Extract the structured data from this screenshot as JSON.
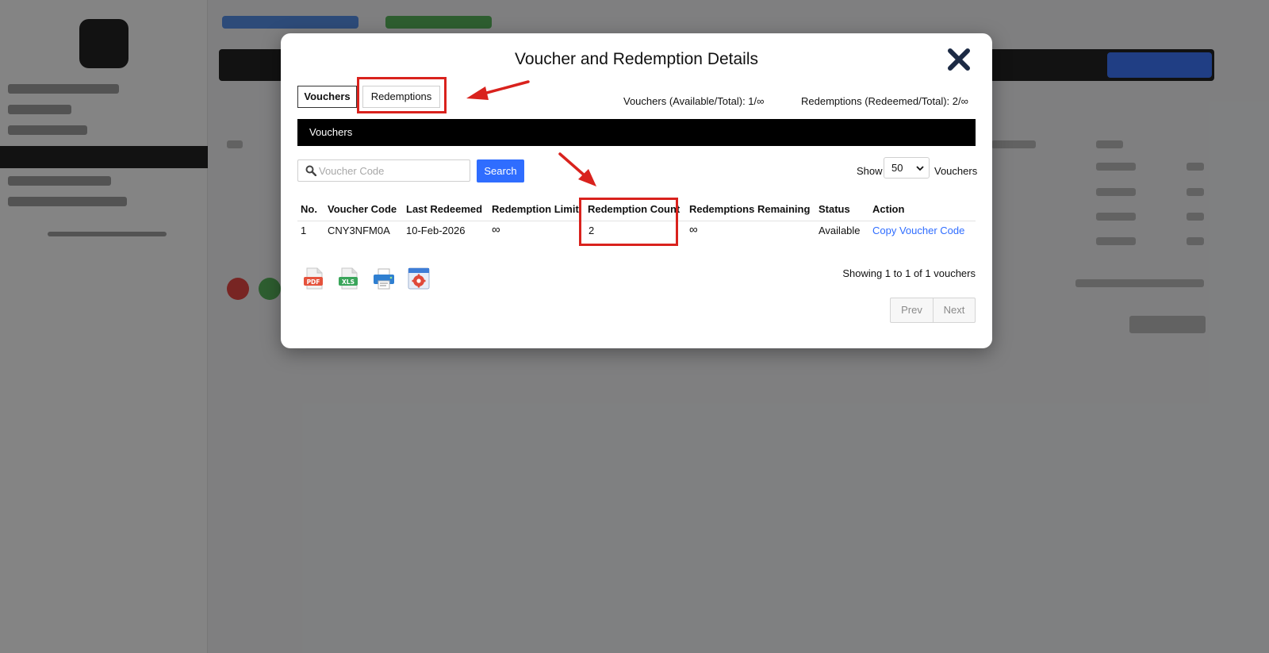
{
  "modal": {
    "title": "Voucher and Redemption Details",
    "tabs": [
      {
        "label": "Vouchers",
        "active": true
      },
      {
        "label": "Redemptions",
        "active": false
      }
    ],
    "stats": {
      "vouchers": "Vouchers (Available/Total): 1/∞",
      "redemptions": "Redemptions (Redeemed/Total): 2/∞"
    },
    "section_title": "Vouchers",
    "search": {
      "placeholder": "Voucher Code",
      "button_label": "Search"
    },
    "page_size": {
      "prefix": "Show",
      "value": "50",
      "suffix": "Vouchers"
    },
    "table": {
      "columns": [
        "No.",
        "Voucher Code",
        "Last Redeemed",
        "Redemption Limit",
        "Redemption Count",
        "Redemptions Remaining",
        "Status",
        "Action"
      ],
      "rows": [
        {
          "no": "1",
          "code": "CNY3NFM0A",
          "last_redeemed": "10-Feb-2026",
          "limit": "∞",
          "count": "2",
          "remaining": "∞",
          "status": "Available",
          "action": "Copy Voucher Code"
        }
      ]
    },
    "export_icons": [
      "pdf-export-icon",
      "xls-export-icon",
      "print-icon",
      "settings-icon"
    ],
    "export_labels": {
      "pdf": "PDF",
      "xls": "XLS"
    },
    "showing": "Showing 1 to 1 of 1 vouchers",
    "pagination": {
      "prev": "Prev",
      "next": "Next"
    }
  },
  "colors": {
    "accent_blue": "#2f6dff",
    "highlight_red": "#d9221d",
    "section_bar": "#000000"
  }
}
